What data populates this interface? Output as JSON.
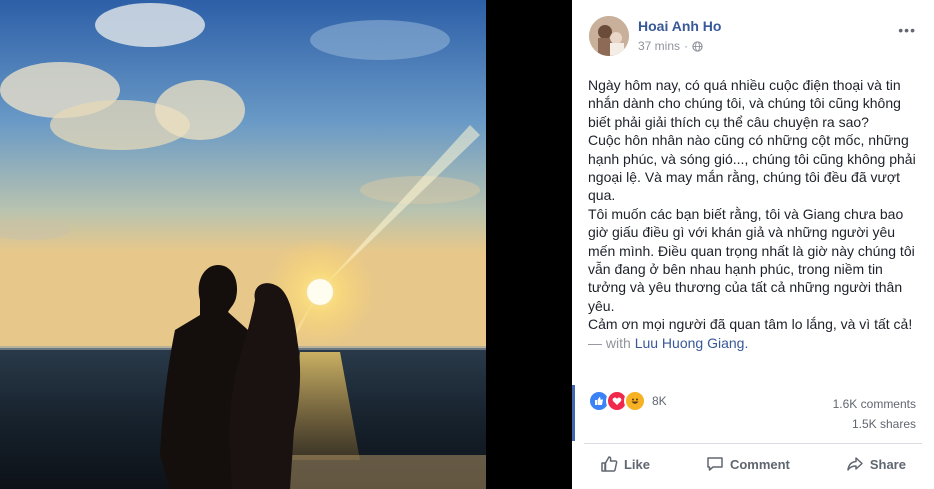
{
  "photo": {
    "alt_icon": "sunset-couple-silhouette-photo"
  },
  "post": {
    "author": "Hoai Anh Ho",
    "time": "37 mins",
    "privacy_icon": "globe-icon",
    "more_icon": "ellipsis-icon",
    "paragraphs": [
      "Ngày hôm nay, có quá nhiều cuộc điện thoại và tin nhắn dành cho chúng tôi, và chúng tôi cũng không biết phải giải thích cụ thể câu chuyện ra sao?",
      "Cuộc hôn nhân nào cũng có những cột mốc, những hạnh phúc, và sóng gió..., chúng tôi cũng không phải ngoại lệ. Và may mắn rằng, chúng tôi đều đã vượt qua.",
      "Tôi muốn các bạn biết rằng, tôi và Giang chưa bao giờ giấu điều gì với khán giả và những người yêu mến mình. Điều quan trọng nhất là giờ này chúng tôi vẫn đang ở bên nhau hạnh phúc, trong niềm tin tưởng và yêu thương của tất cả những người thân yêu.",
      "Cảm ơn mọi người đã quan tâm lo lắng, và vì tất cả!"
    ],
    "with_label": "— with",
    "tagged": "Luu Huong Giang."
  },
  "reactions": {
    "count": "8K",
    "icons": [
      "like-icon",
      "love-icon",
      "haha-icon"
    ],
    "colors": {
      "like": "#3b82f6",
      "love": "#f0284a",
      "haha": "#f7b125"
    }
  },
  "stats": {
    "comments": "1.6K comments",
    "shares": "1.5K shares"
  },
  "actions": {
    "like": "Like",
    "comment": "Comment",
    "share": "Share"
  },
  "colors": {
    "link": "#385898",
    "accent": "#4267b2",
    "muted": "#606770"
  }
}
